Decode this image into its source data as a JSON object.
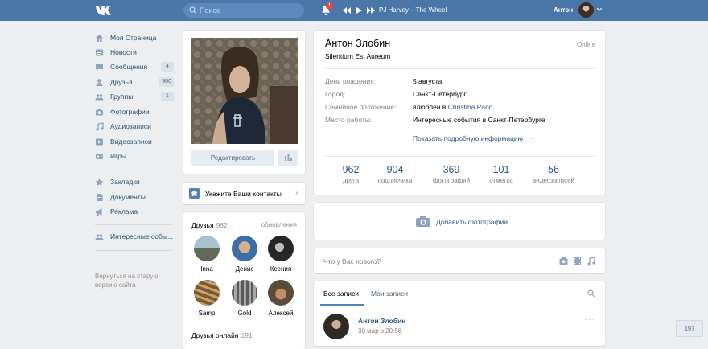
{
  "header": {
    "search_placeholder": "Поиск",
    "notifications_count": "1",
    "track_title": "PJ Harvey – The Wheel",
    "user_name": "Антон"
  },
  "sidebar": {
    "items": [
      {
        "label": "Моя Страница",
        "icon": "home-icon",
        "count": ""
      },
      {
        "label": "Новости",
        "icon": "news-icon",
        "count": ""
      },
      {
        "label": "Сообщения",
        "icon": "messages-icon",
        "count": "4"
      },
      {
        "label": "Друзья",
        "icon": "friends-icon",
        "count": "900"
      },
      {
        "label": "Группы",
        "icon": "groups-icon",
        "count": "1"
      },
      {
        "label": "Фотографии",
        "icon": "camera-icon",
        "count": ""
      },
      {
        "label": "Аудиозаписи",
        "icon": "music-note-icon",
        "count": ""
      },
      {
        "label": "Видеозаписи",
        "icon": "video-icon",
        "count": ""
      },
      {
        "label": "Игры",
        "icon": "gamepad-icon",
        "count": ""
      },
      {
        "label": "Закладки",
        "icon": "star-icon",
        "count": ""
      },
      {
        "label": "Документы",
        "icon": "document-icon",
        "count": ""
      },
      {
        "label": "Реклама",
        "icon": "megaphone-icon",
        "count": ""
      },
      {
        "label": "Интересные собы...",
        "icon": "people-icon",
        "count": ""
      }
    ],
    "old_version": "Вернуться на старую версию сайта"
  },
  "profile": {
    "edit_button": "Редактировать",
    "name": "Антон Злобин",
    "status": "Silentium Est Aureum",
    "online": "Online",
    "info": [
      {
        "key": "День рождения:",
        "value": "5 августа"
      },
      {
        "key": "Город:",
        "value": "Санкт-Петербург"
      },
      {
        "key": "Семейное положение:",
        "value_prefix": "влюблён в",
        "value_link": "Christina Parlo"
      },
      {
        "key": "Место работы:",
        "value": "Интересные события в Санкт-Петербурге"
      }
    ],
    "more_info": "Показать подробную информацию",
    "counters": [
      {
        "num": "962",
        "label": "друга"
      },
      {
        "num": "904",
        "label": "подписчика"
      },
      {
        "num": "369",
        "label": "фотографий"
      },
      {
        "num": "101",
        "label": "отметка"
      },
      {
        "num": "56",
        "label": "видеозаписей"
      }
    ]
  },
  "contacts": {
    "text": "Укажите Ваши контакты",
    "close": "×"
  },
  "friends": {
    "title": "Друзья",
    "count": "962",
    "updates": "обновления",
    "list": [
      {
        "name": "Inna"
      },
      {
        "name": "Денис"
      },
      {
        "name": "Ксения"
      },
      {
        "name": "Samp"
      },
      {
        "name": "Gold"
      },
      {
        "name": "Алексей"
      }
    ],
    "online_title": "Друзья онлайн",
    "online_count": "191"
  },
  "add_photos": {
    "label": "Добавить фотографии"
  },
  "composer": {
    "placeholder": "Что у Вас нового?"
  },
  "wall": {
    "tab_all": "Все записи",
    "tab_mine": "Мои записи",
    "post_author": "Антон Злобин",
    "post_date": "30 мар в 20:56",
    "dots": "···"
  },
  "page_counter": "197"
}
